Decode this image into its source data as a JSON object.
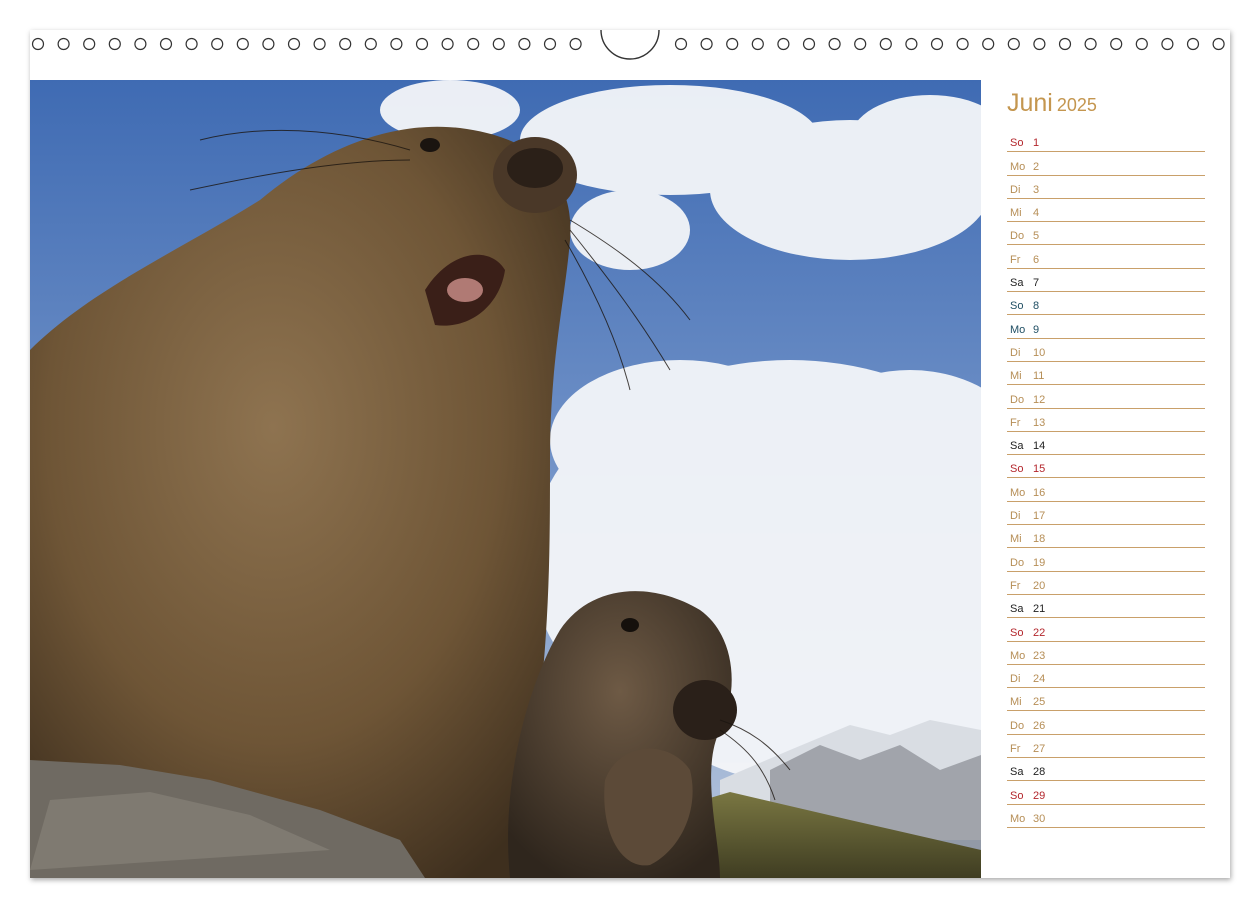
{
  "calendar": {
    "month": "Juni",
    "year": "2025",
    "colors": {
      "weekday": "#b68e56",
      "saturday": "#222222",
      "sunday": "#b3262c",
      "holiday": "#1f4e63",
      "rule": "#c9a06a"
    },
    "days": [
      {
        "wd": "So",
        "d": "1",
        "kind": "sunday"
      },
      {
        "wd": "Mo",
        "d": "2",
        "kind": "weekday"
      },
      {
        "wd": "Di",
        "d": "3",
        "kind": "weekday"
      },
      {
        "wd": "Mi",
        "d": "4",
        "kind": "weekday"
      },
      {
        "wd": "Do",
        "d": "5",
        "kind": "weekday"
      },
      {
        "wd": "Fr",
        "d": "6",
        "kind": "weekday"
      },
      {
        "wd": "Sa",
        "d": "7",
        "kind": "saturday"
      },
      {
        "wd": "So",
        "d": "8",
        "kind": "holiday"
      },
      {
        "wd": "Mo",
        "d": "9",
        "kind": "holiday"
      },
      {
        "wd": "Di",
        "d": "10",
        "kind": "weekday"
      },
      {
        "wd": "Mi",
        "d": "11",
        "kind": "weekday"
      },
      {
        "wd": "Do",
        "d": "12",
        "kind": "weekday"
      },
      {
        "wd": "Fr",
        "d": "13",
        "kind": "weekday"
      },
      {
        "wd": "Sa",
        "d": "14",
        "kind": "saturday"
      },
      {
        "wd": "So",
        "d": "15",
        "kind": "sunday"
      },
      {
        "wd": "Mo",
        "d": "16",
        "kind": "weekday"
      },
      {
        "wd": "Di",
        "d": "17",
        "kind": "weekday"
      },
      {
        "wd": "Mi",
        "d": "18",
        "kind": "weekday"
      },
      {
        "wd": "Do",
        "d": "19",
        "kind": "weekday"
      },
      {
        "wd": "Fr",
        "d": "20",
        "kind": "weekday"
      },
      {
        "wd": "Sa",
        "d": "21",
        "kind": "saturday"
      },
      {
        "wd": "So",
        "d": "22",
        "kind": "sunday"
      },
      {
        "wd": "Mo",
        "d": "23",
        "kind": "weekday"
      },
      {
        "wd": "Di",
        "d": "24",
        "kind": "weekday"
      },
      {
        "wd": "Mi",
        "d": "25",
        "kind": "weekday"
      },
      {
        "wd": "Do",
        "d": "26",
        "kind": "weekday"
      },
      {
        "wd": "Fr",
        "d": "27",
        "kind": "weekday"
      },
      {
        "wd": "Sa",
        "d": "28",
        "kind": "saturday"
      },
      {
        "wd": "So",
        "d": "29",
        "kind": "sunday"
      },
      {
        "wd": "Mo",
        "d": "30",
        "kind": "weekday"
      }
    ]
  },
  "photo": {
    "subject": "marmot-photo",
    "colors": {
      "sky": "#4f77b8",
      "cloud": "#f3f5f8",
      "fur": "#7a6040",
      "rock": "#6f6a62",
      "grass": "#6b6a3a"
    }
  },
  "binding": {
    "icon": "spiral-binding-icon"
  }
}
